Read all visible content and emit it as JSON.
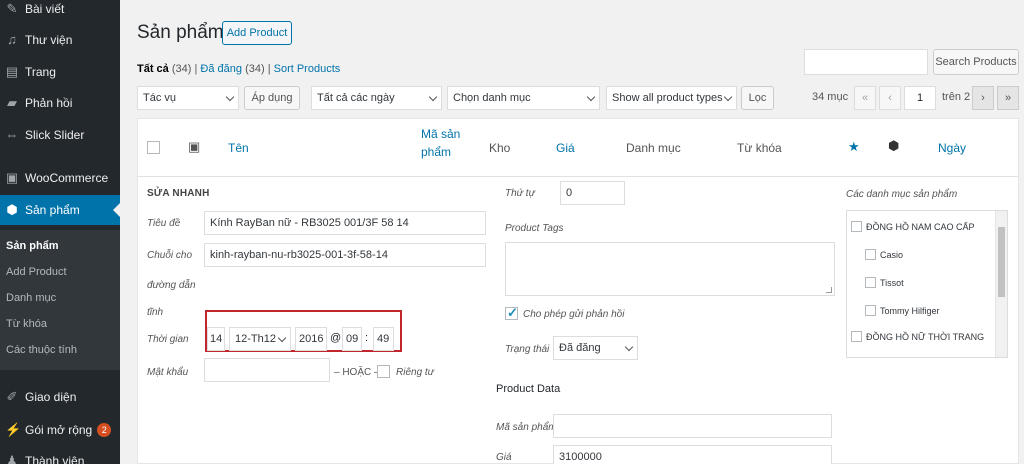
{
  "sidebar": {
    "items": [
      {
        "label": "Bài viết",
        "icon": "pin-icon"
      },
      {
        "label": "Thư viện",
        "icon": "media-icon"
      },
      {
        "label": "Trang",
        "icon": "page-icon"
      },
      {
        "label": "Phản hồi",
        "icon": "comment-icon"
      },
      {
        "label": "Slick Slider",
        "icon": "slider-icon"
      },
      {
        "label": "WooCommerce",
        "icon": "woocommerce-icon"
      },
      {
        "label": "Sản phẩm",
        "icon": "product-icon"
      },
      {
        "label": "Giao diện",
        "icon": "brush-icon"
      },
      {
        "label": "Gói mở rộng",
        "icon": "plugin-icon",
        "badge": "2"
      },
      {
        "label": "Thành viên",
        "icon": "user-icon"
      }
    ],
    "submenu": [
      "Sản phẩm",
      "Add Product",
      "Danh mục",
      "Từ khóa",
      "Các thuộc tính"
    ]
  },
  "header": {
    "title": "Sản phẩm",
    "add_label": "Add Product",
    "filters": {
      "all_label": "Tất cả",
      "all_count": "(34)",
      "published_label": "Đã đăng",
      "published_count": "(34)",
      "sort_label": "Sort Products",
      "sep": "|"
    },
    "search_button": "Search Products"
  },
  "toolbar": {
    "bulk_action": "Tác vụ",
    "apply": "Áp dụng",
    "dates": "Tất cả các ngày",
    "category": "Chọn danh mục",
    "product_types": "Show all product types",
    "filter": "Lọc",
    "items_count": "34 mục",
    "first": "«",
    "prev": "‹",
    "current_page": "1",
    "total": "trên 2",
    "next": "›",
    "last": "»"
  },
  "table": {
    "columns": {
      "name": "Tên",
      "sku_line1": "Mã sản",
      "sku_line2": "phẩm",
      "stock": "Kho",
      "price": "Giá",
      "categories": "Danh mục",
      "tags": "Từ khóa",
      "date": "Ngày",
      "featured_icon": "star-icon",
      "type_icon": "box-icon",
      "image_icon": "image-icon"
    }
  },
  "quick_edit": {
    "heading": "SỬA NHANH",
    "title_label": "Tiêu đề",
    "title_value": "Kính RayBan nữ - RB3025 001/3F 58 14",
    "slug_label_1": "Chuỗi cho",
    "slug_label_2": "đường dẫn",
    "slug_label_3": "tĩnh",
    "slug_value": "kinh-rayban-nu-rb3025-001-3f-58-14",
    "date_label": "Thời gian",
    "day": "14",
    "month": "12-Th12",
    "year": "2016",
    "at": "@",
    "hour": "09",
    "colon": ":",
    "minute": "49",
    "password_label": "Mật khẩu",
    "or_label": "– HOẶC –",
    "private_label": "Riêng tư",
    "order_label": "Thứ tự",
    "order_value": "0",
    "tags_label": "Product Tags",
    "allow_comments": "Cho phép gửi phản hồi",
    "status_label": "Trạng thái",
    "status_value": "Đã đăng",
    "product_data": "Product Data",
    "sku_label": "Mã sản phẩm",
    "price_label": "Giá",
    "price_value": "3100000",
    "categories_label": "Các danh mục sản phẩm",
    "categories": [
      "ĐỒNG HỒ NAM CAO CẤP",
      "Casio",
      "Tissot",
      "Tommy Hilfiger",
      "ĐỒNG HỒ NỮ THỜI TRANG"
    ]
  }
}
